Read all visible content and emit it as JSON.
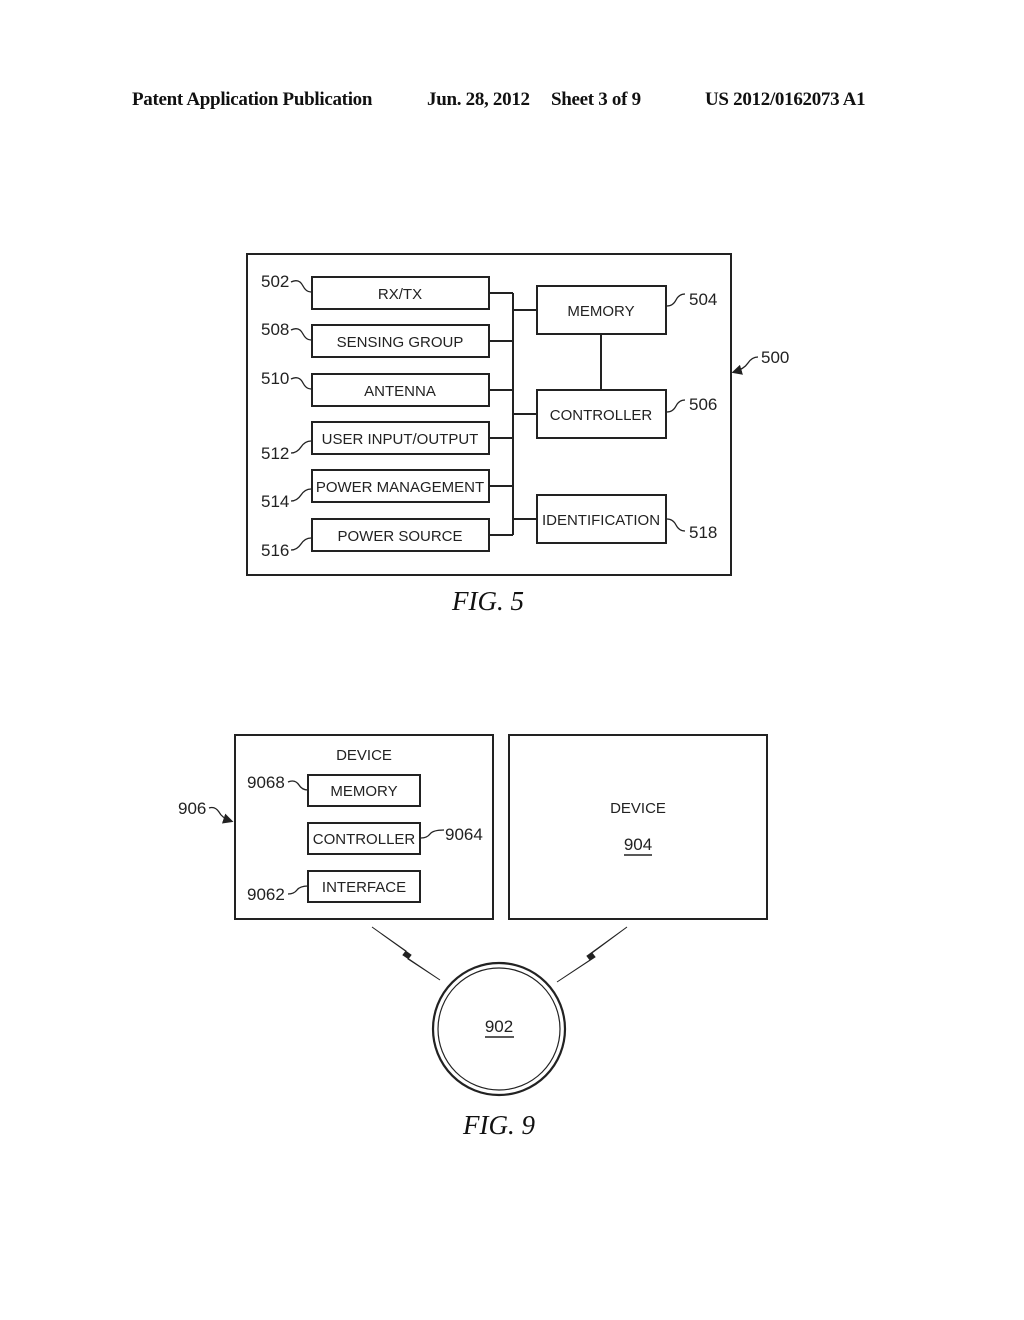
{
  "header": {
    "publication": "Patent Application Publication",
    "date": "Jun. 28, 2012",
    "sheet": "Sheet 3 of 9",
    "number": "US 2012/0162073 A1"
  },
  "fig5": {
    "caption": "FIG. 5",
    "system_ref": "500",
    "left_blocks": [
      {
        "ref": "502",
        "label": "RX/TX"
      },
      {
        "ref": "508",
        "label": "SENSING GROUP"
      },
      {
        "ref": "510",
        "label": "ANTENNA"
      },
      {
        "ref": "512",
        "label": "USER INPUT/OUTPUT"
      },
      {
        "ref": "514",
        "label": "POWER MANAGEMENT"
      },
      {
        "ref": "516",
        "label": "POWER SOURCE"
      }
    ],
    "right_blocks": [
      {
        "ref": "504",
        "label": "MEMORY"
      },
      {
        "ref": "506",
        "label": "CONTROLLER"
      },
      {
        "ref": "518",
        "label": "IDENTIFICATION"
      }
    ]
  },
  "fig9": {
    "caption": "FIG. 9",
    "device_906": {
      "ref": "906",
      "title": "DEVICE",
      "blocks": [
        {
          "ref": "9068",
          "label": "MEMORY"
        },
        {
          "ref": "9064",
          "label": "CONTROLLER"
        },
        {
          "ref": "9062",
          "label": "INTERFACE"
        }
      ]
    },
    "device_904": {
      "title": "DEVICE",
      "ref": "904"
    },
    "network": {
      "ref": "902"
    }
  }
}
